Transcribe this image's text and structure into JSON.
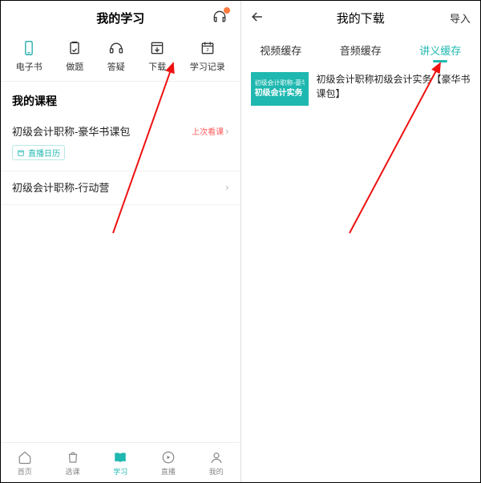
{
  "left": {
    "header_title": "我的学习",
    "nav": [
      {
        "label": "电子书"
      },
      {
        "label": "做题"
      },
      {
        "label": "答疑"
      },
      {
        "label": "下载"
      },
      {
        "label": "学习记录"
      }
    ],
    "section_title": "我的课程",
    "courses": [
      {
        "name": "初级会计职称-豪华书课包",
        "tag_last": "上次看课",
        "calendar": "直播日历"
      },
      {
        "name": "初级会计职称-行动营"
      }
    ],
    "tabs": [
      {
        "label": "首页"
      },
      {
        "label": "选课"
      },
      {
        "label": "学习"
      },
      {
        "label": "直播"
      },
      {
        "label": "我的"
      }
    ]
  },
  "right": {
    "header_title": "我的下载",
    "import_label": "导入",
    "tabs": [
      {
        "label": "视频缓存"
      },
      {
        "label": "音频缓存"
      },
      {
        "label": "讲义缓存"
      }
    ],
    "item": {
      "thumb_line1": "初级会计职称-豪华...",
      "thumb_line2": "初级会计实务",
      "title": "初级会计职称初级会计实务【豪华书课包】"
    }
  },
  "colors": {
    "accent": "#1fb8b0"
  }
}
